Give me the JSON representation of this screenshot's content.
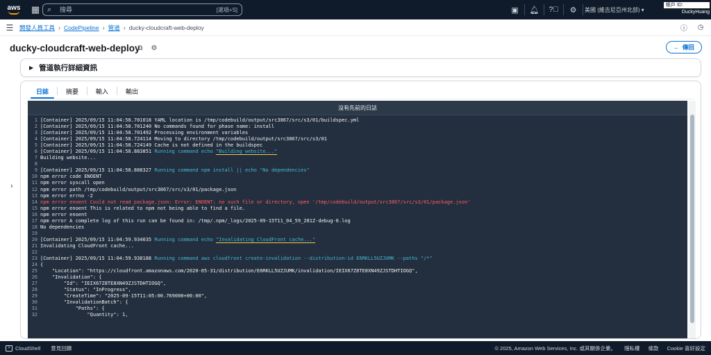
{
  "topbar": {
    "logo": "aws",
    "search_placeholder": "搜尋",
    "search_shortcut": "[選項+S]",
    "region": "美國 (維吉尼亞州北部)",
    "account_id_label": "帳戶 ID:",
    "user": "DuckyHuang",
    "icons": [
      "grid-icon",
      "search-icon",
      "terminal-icon",
      "bell-icon",
      "help-icon",
      "settings-icon"
    ]
  },
  "breadcrumb": {
    "items": [
      "開發人員工具",
      "CodePipeline",
      "管道"
    ],
    "current": "ducky-cloudcraft-web-deploy"
  },
  "page": {
    "title": "ducky-cloudcraft-web-deploy",
    "back_label": "傳回"
  },
  "exec_section": {
    "label": "管道執行詳細資訊"
  },
  "tabs": [
    "日誌",
    "摘要",
    "輸入",
    "輸出"
  ],
  "active_tab": "日誌",
  "log": {
    "header": "沒有先前的日誌",
    "lines": [
      {
        "n": "1",
        "t": "[Container] 2025/09/15 11:04:58.701018 YAML location is /tmp/codebuild/output/src3867/src/s3/01/buildspec.yml"
      },
      {
        "n": "2",
        "t": "[Container] 2025/09/15 11:04:58.701240 No commands found for phase name: install"
      },
      {
        "n": "3",
        "t": "[Container] 2025/09/15 11:04:58.701492 Processing environment variables"
      },
      {
        "n": "4",
        "t": "[Container] 2025/09/15 11:04:58.724114 Moving to directory /tmp/codebuild/output/src3867/src/s3/01"
      },
      {
        "n": "5",
        "t": "[Container] 2025/09/15 11:04:58.724149 Cache is not defined in the buildspec"
      },
      {
        "n": "6",
        "t": "[Container] 2025/09/15 11:04:58.883851 ",
        "c": "Running command echo ",
        "h": "\"Building website...\""
      },
      {
        "n": "7",
        "t": "Building website..."
      },
      {
        "n": "8",
        "t": ""
      },
      {
        "n": "9",
        "t": "[Container] 2025/09/15 11:04:58.888327 ",
        "c": "Running command npm install || echo \"No dependencies\""
      },
      {
        "n": "10",
        "t": "npm error code ENOENT"
      },
      {
        "n": "11",
        "t": "npm error syscall open"
      },
      {
        "n": "12",
        "t": "npm error path /tmp/codebuild/output/src3867/src/s3/01/package.json"
      },
      {
        "n": "13",
        "t": "npm error errno -2"
      },
      {
        "n": "14",
        "t": "npm error enoent Could not read package.json: Error: ENOENT: no such file or directory, open '/tmp/codebuild/output/src3867/src/s3/01/package.json'",
        "e": true
      },
      {
        "n": "15",
        "t": "npm error enoent This is related to npm not being able to find a file."
      },
      {
        "n": "16",
        "t": "npm error enoent"
      },
      {
        "n": "17",
        "t": "npm error A complete log of this run can be found in: /tmp/.npm/_logs/2025-09-15T11_04_59_281Z-debug-0.log"
      },
      {
        "n": "18",
        "t": "No dependencies"
      },
      {
        "n": "19",
        "t": ""
      },
      {
        "n": "20",
        "t": "[Container] 2025/09/15 11:04:59.934035 ",
        "c": "Running command echo ",
        "h": "\"Invalidating CloudFront cache...\""
      },
      {
        "n": "21",
        "t": "Invalidating CloudFront cache..."
      },
      {
        "n": "22",
        "t": ""
      },
      {
        "n": "23",
        "t": "[Container] 2025/09/15 11:04:59.938188 ",
        "c": "Running command aws cloudfront create-invalidation --distribution-id E6RKLL5UZJUMK --paths \"/*\""
      },
      {
        "n": "24",
        "t": "{"
      },
      {
        "n": "25",
        "t": "    \"Location\": \"https://cloudfront.amazonaws.com/2020-05-31/distribution/E6RKLL5UZJUMK/invalidation/IEIX67Z8TE8XN49ZJSTDHTIOGQ\","
      },
      {
        "n": "26",
        "t": "    \"Invalidation\": {"
      },
      {
        "n": "27",
        "t": "        \"Id\": \"IEIX67Z8TE8XN49ZJSTDHTIOGQ\","
      },
      {
        "n": "28",
        "t": "        \"Status\": \"InProgress\","
      },
      {
        "n": "29",
        "t": "        \"CreateTime\": \"2025-09-15T11:05:00.769000+00:00\","
      },
      {
        "n": "30",
        "t": "        \"InvalidationBatch\": {"
      },
      {
        "n": "31",
        "t": "            \"Paths\": {"
      },
      {
        "n": "32",
        "t": "                \"Quantity\": 1,"
      }
    ]
  },
  "footer": {
    "cloudshell": "CloudShell",
    "feedback": "意見回饋",
    "copyright": "© 2025, Amazon Web Services, Inc. 或其關係企業。",
    "privacy": "隱私權",
    "terms": "條款",
    "cookie": "Cookie 喜好設定"
  },
  "colors": {
    "topbar": "#0f1b2a",
    "link": "#0972d3",
    "terminal_bg": "#232f3e",
    "command": "#44b9d6",
    "error": "#ff5d64",
    "highlight_underline": "#f2c94c"
  }
}
